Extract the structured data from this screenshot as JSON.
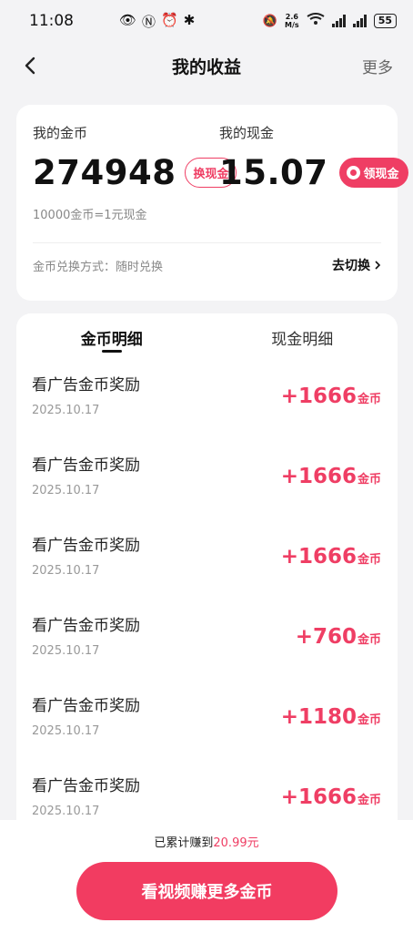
{
  "status_bar": {
    "time": "11:08",
    "network_speed_value": "2.6",
    "network_speed_unit": "M/s",
    "battery": "55"
  },
  "nav": {
    "title": "我的收益",
    "more_label": "更多"
  },
  "summary": {
    "coin_label": "我的金币",
    "coin_value": "274948",
    "exchange_button": "换现金",
    "cash_label": "我的现金",
    "cash_value": "15.07",
    "withdraw_button": "领现金",
    "rate_text": "10000金币=1元现金",
    "exchange_method_text": "金币兑换方式：随时兑换",
    "switch_label": "去切换"
  },
  "tabs": [
    {
      "label": "金币明细",
      "active": true
    },
    {
      "label": "现金明细",
      "active": false
    }
  ],
  "records": [
    {
      "title": "看广告金币奖励",
      "date": "2025.10.17",
      "amount": "+1666",
      "unit": "金币"
    },
    {
      "title": "看广告金币奖励",
      "date": "2025.10.17",
      "amount": "+1666",
      "unit": "金币"
    },
    {
      "title": "看广告金币奖励",
      "date": "2025.10.17",
      "amount": "+1666",
      "unit": "金币"
    },
    {
      "title": "看广告金币奖励",
      "date": "2025.10.17",
      "amount": "+760",
      "unit": "金币"
    },
    {
      "title": "看广告金币奖励",
      "date": "2025.10.17",
      "amount": "+1180",
      "unit": "金币"
    },
    {
      "title": "看广告金币奖励",
      "date": "2025.10.17",
      "amount": "+1666",
      "unit": "金币"
    }
  ],
  "footer": {
    "earned_prefix": "已累计赚到",
    "earned_value": "20.99元",
    "cta_label": "看视频赚更多金币"
  },
  "colors": {
    "accent": "#ef3e64",
    "background": "#f3f3f5"
  }
}
